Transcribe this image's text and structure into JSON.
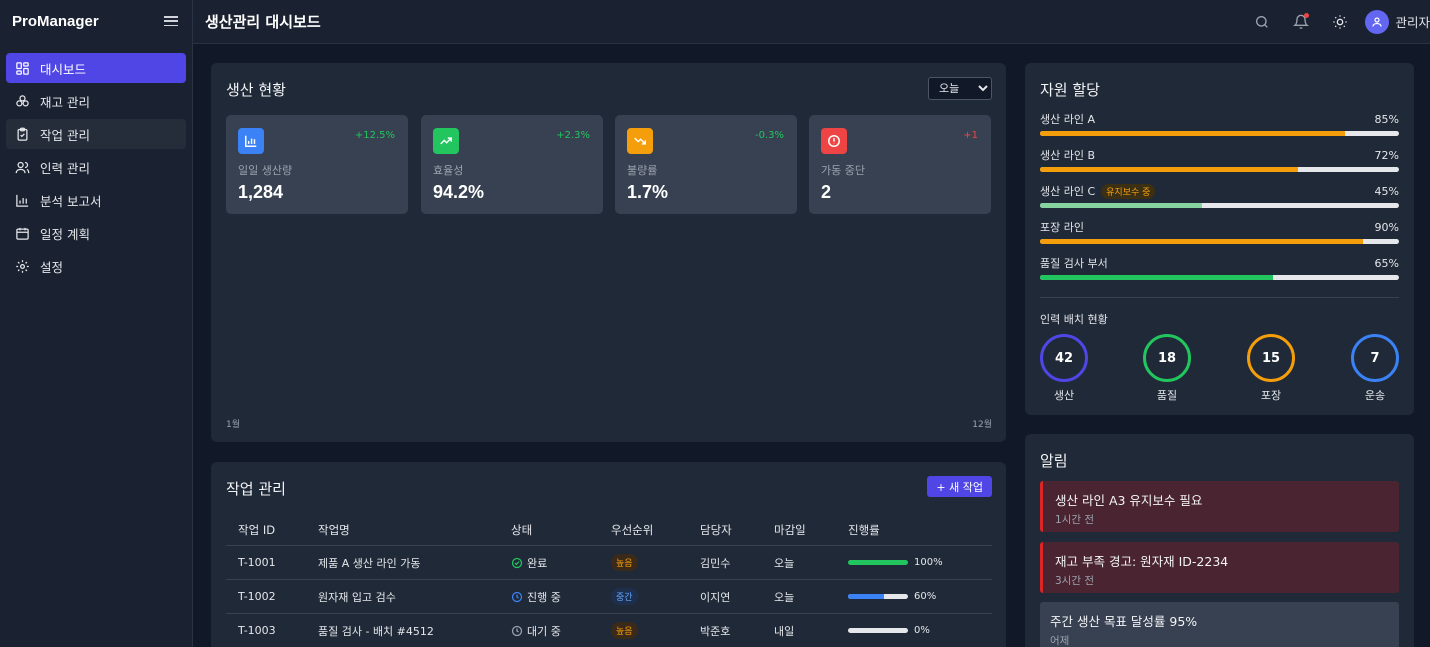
{
  "app": {
    "brand": "ProManager",
    "page_title": "생산관리 대시보드",
    "user_name": "관리자"
  },
  "sidebar": {
    "items": [
      {
        "label": "대시보드",
        "icon": "dashboard-icon",
        "active": true
      },
      {
        "label": "재고 관리",
        "icon": "boxes-icon"
      },
      {
        "label": "작업 관리",
        "icon": "clipboard-icon"
      },
      {
        "label": "인력 관리",
        "icon": "users-icon"
      },
      {
        "label": "분석 보고서",
        "icon": "bar-chart-icon"
      },
      {
        "label": "일정 계획",
        "icon": "calendar-icon"
      },
      {
        "label": "설정",
        "icon": "gear-icon"
      }
    ]
  },
  "production": {
    "title": "생산 현황",
    "period_selected": "오늘",
    "axis_start": "1월",
    "axis_end": "12월",
    "stats": [
      {
        "label": "일일 생산량",
        "value": "1,284",
        "delta": "+12.5%",
        "icon": "bar-chart-icon",
        "icon_color": "#3b82f6",
        "delta_color": "#22c55e"
      },
      {
        "label": "효율성",
        "value": "94.2%",
        "delta": "+2.3%",
        "icon": "trending-up-icon",
        "icon_color": "#22c55e",
        "delta_color": "#22c55e"
      },
      {
        "label": "불량률",
        "value": "1.7%",
        "delta": "-0.3%",
        "icon": "trending-down-icon",
        "icon_color": "#f59e0b",
        "delta_color": "#22c55e"
      },
      {
        "label": "가동 중단",
        "value": "2",
        "delta": "+1",
        "icon": "alert-circle-icon",
        "icon_color": "#ef4444",
        "delta_color": "#ef4444"
      }
    ]
  },
  "tasks": {
    "title": "작업 관리",
    "new_button": "+ 새 작업",
    "columns": [
      "작업 ID",
      "작업명",
      "상태",
      "우선순위",
      "담당자",
      "마감일",
      "진행률"
    ],
    "rows": [
      {
        "id": "T-1001",
        "name": "제품 A 생산 라인 가동",
        "status": "완료",
        "status_icon": "check-circle-icon",
        "status_color": "#22c55e",
        "priority": "높음",
        "priority_bg": "#3b2a1a",
        "priority_color": "#f59e0b",
        "assignee": "김민수",
        "due": "오늘",
        "progress": 100,
        "progress_label": "100%",
        "bar_color": "#22c55e"
      },
      {
        "id": "T-1002",
        "name": "원자재 입고 검수",
        "status": "진행 중",
        "status_icon": "clock-icon",
        "status_color": "#3b82f6",
        "priority": "중간",
        "priority_bg": "#1e2f4d",
        "priority_color": "#60a5fa",
        "assignee": "이지연",
        "due": "오늘",
        "progress": 60,
        "progress_label": "60%",
        "bar_color": "#3b82f6"
      },
      {
        "id": "T-1003",
        "name": "품질 검사 - 배치 #4512",
        "status": "대기 중",
        "status_icon": "clock-icon",
        "status_color": "#9ca3af",
        "priority": "높음",
        "priority_bg": "#3b2a1a",
        "priority_color": "#f59e0b",
        "assignee": "박준호",
        "due": "내일",
        "progress": 0,
        "progress_label": "0%",
        "bar_color": "#9ca3af"
      }
    ]
  },
  "resources": {
    "title": "자원 할당",
    "lines": [
      {
        "name": "생산 라인 A",
        "percent_label": "85%",
        "value": 85,
        "color": "#f59e0b"
      },
      {
        "name": "생산 라인 B",
        "percent_label": "72%",
        "value": 72,
        "color": "#f59e0b"
      },
      {
        "name": "생산 라인 C",
        "badge": "유지보수 중",
        "percent_label": "45%",
        "value": 45,
        "color": "#86d3a0"
      },
      {
        "name": "포장 라인",
        "percent_label": "90%",
        "value": 90,
        "color": "#f59e0b"
      },
      {
        "name": "품질 검사 부서",
        "percent_label": "65%",
        "value": 65,
        "color": "#22c55e"
      }
    ],
    "staff_title": "인력 배치 현황",
    "staff": [
      {
        "count": "42",
        "label": "생산",
        "color": "#4f46e5"
      },
      {
        "count": "18",
        "label": "품질",
        "color": "#22c55e"
      },
      {
        "count": "15",
        "label": "포장",
        "color": "#f59e0b"
      },
      {
        "count": "7",
        "label": "운송",
        "color": "#3b82f6"
      }
    ]
  },
  "alerts": {
    "title": "알림",
    "items": [
      {
        "text": "생산 라인 A3 유지보수 필요",
        "time": "1시간 전",
        "level": "red"
      },
      {
        "text": "재고 부족 경고: 원자재 ID-2234",
        "time": "3시간 전",
        "level": "red"
      },
      {
        "text": "주간 생산 목표 달성률 95%",
        "time": "어제",
        "level": "gray"
      }
    ]
  }
}
